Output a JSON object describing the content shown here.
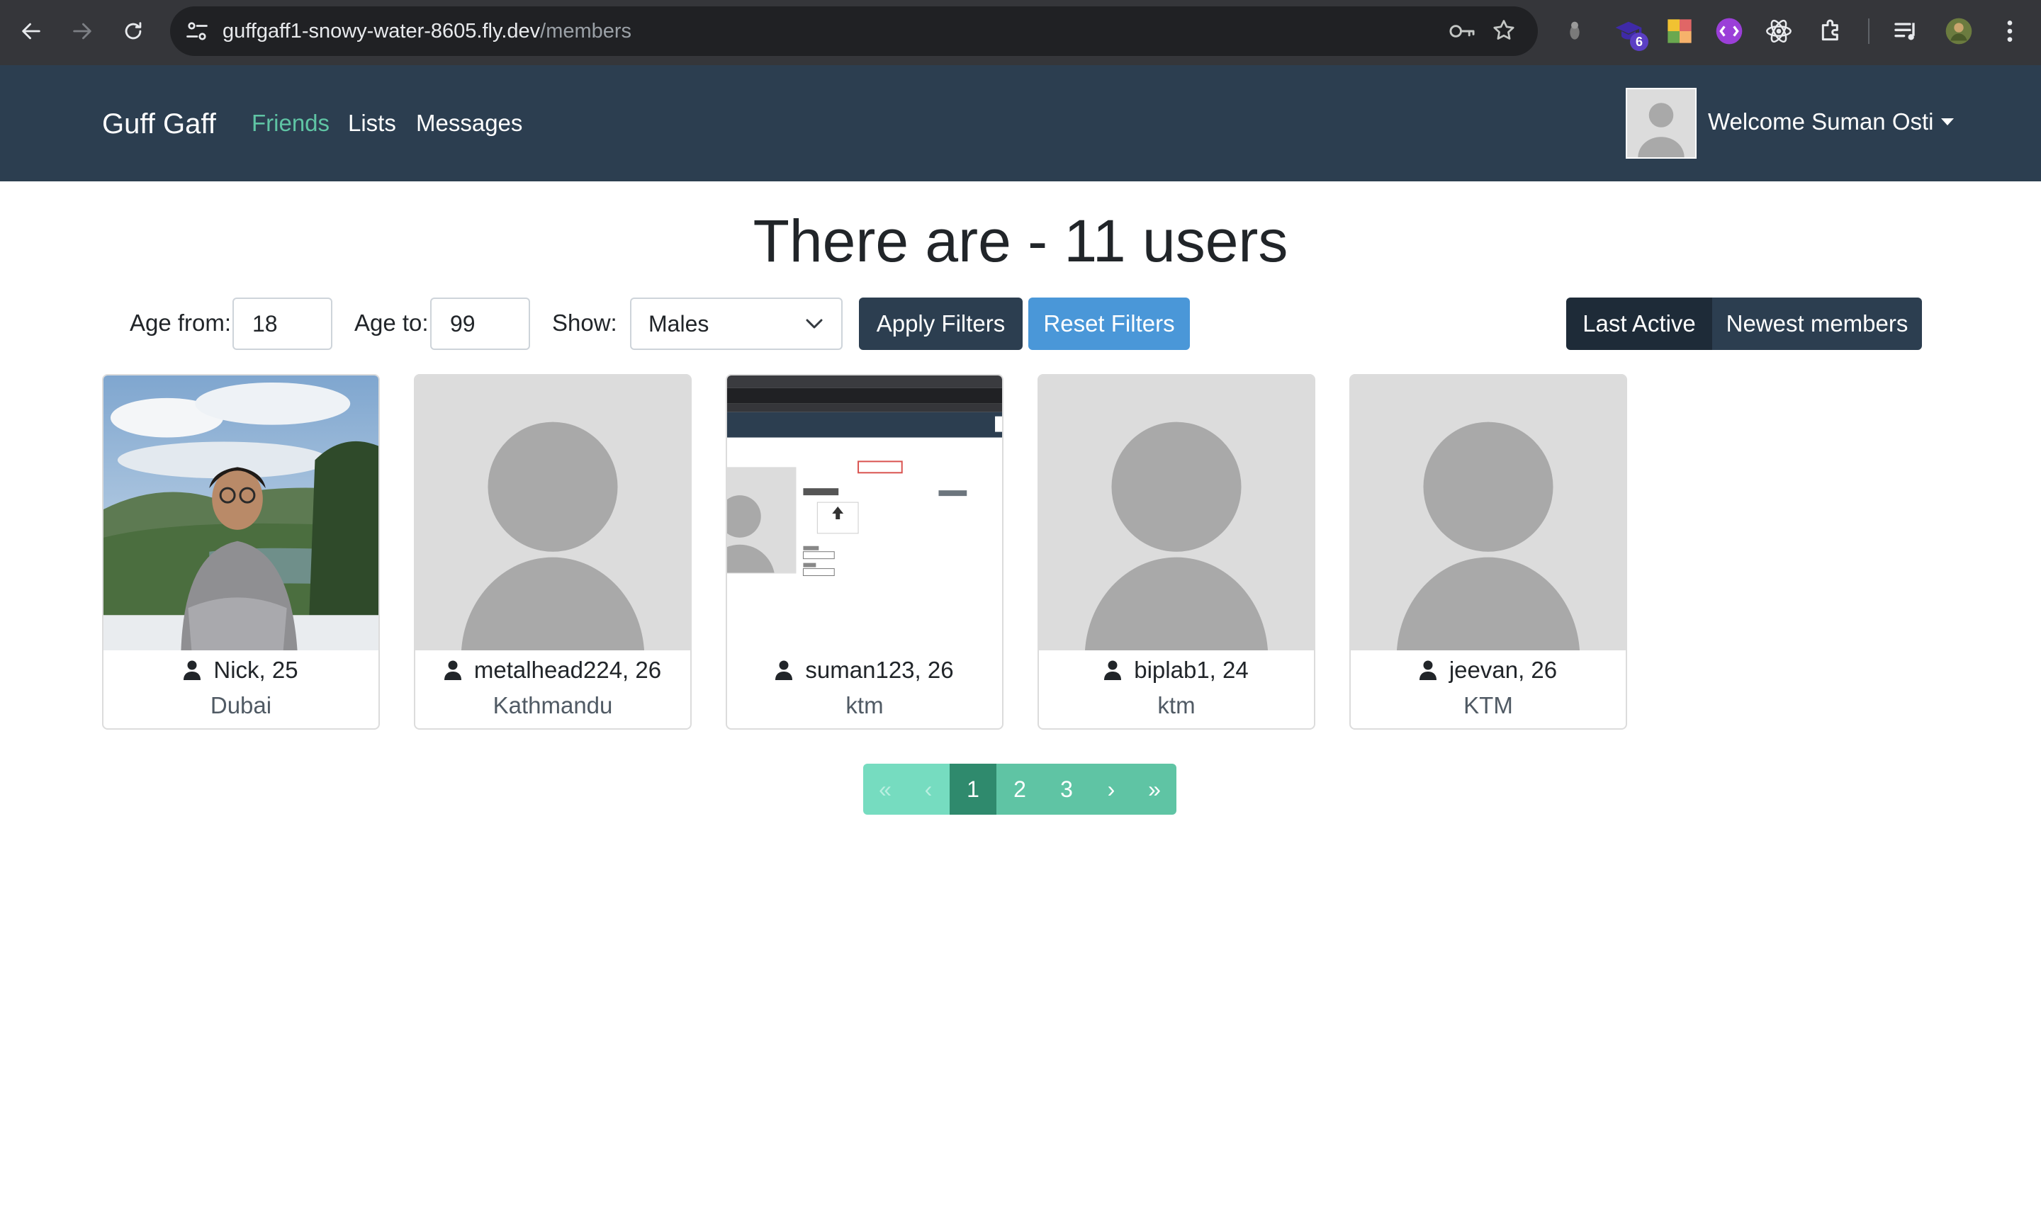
{
  "browser": {
    "url_host": "guffgaff1-snowy-water-8605.fly.dev",
    "url_path": "/members",
    "extension_badge": "6"
  },
  "navbar": {
    "brand": "Guff Gaff",
    "links": [
      {
        "label": "Friends",
        "active": true
      },
      {
        "label": "Lists",
        "active": false
      },
      {
        "label": "Messages",
        "active": false
      }
    ],
    "welcome": "Welcome Suman Osti"
  },
  "heading": "There are - 11 users",
  "filters": {
    "age_from_label": "Age from:",
    "age_from_value": "18",
    "age_to_label": "Age to:",
    "age_to_value": "99",
    "show_label": "Show:",
    "show_value": "Males",
    "apply_label": "Apply Filters",
    "reset_label": "Reset Filters"
  },
  "sort": {
    "last_active_label": "Last Active",
    "newest_label": "Newest members",
    "selected": "Last Active"
  },
  "members": [
    {
      "username": "Nick",
      "age": "25",
      "name_line": "Nick, 25",
      "city": "Dubai",
      "photo": "person-photo"
    },
    {
      "username": "metalhead224",
      "age": "26",
      "name_line": "metalhead224, 26",
      "city": "Kathmandu",
      "photo": "default-avatar"
    },
    {
      "username": "suman123",
      "age": "26",
      "name_line": "suman123, 26",
      "city": "ktm",
      "photo": "screenshot-photo"
    },
    {
      "username": "biplab1",
      "age": "24",
      "name_line": "biplab1, 24",
      "city": "ktm",
      "photo": "default-avatar"
    },
    {
      "username": "jeevan",
      "age": "26",
      "name_line": "jeevan, 26",
      "city": "KTM",
      "photo": "default-avatar"
    }
  ],
  "pagination": {
    "first": "«",
    "prev": "‹",
    "pages": [
      "1",
      "2",
      "3"
    ],
    "current": "1",
    "next": "›",
    "last": "»"
  },
  "colors": {
    "navbar_bg": "#2c3e50",
    "accent_green": "#5fc4a4",
    "pagination_current": "#2f8a6d",
    "info_blue": "#4a97d8"
  }
}
